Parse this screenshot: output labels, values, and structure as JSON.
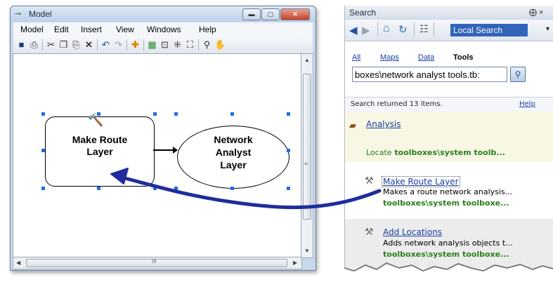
{
  "model_window": {
    "title": "Model",
    "menu": [
      "Model",
      "Edit",
      "Insert",
      "View",
      "Windows",
      "Help"
    ],
    "scroll_right_glyph": "III",
    "diagram": {
      "tool_label": "Make Route Layer",
      "data_label": "Network Analyst Layer"
    }
  },
  "search_window": {
    "title": "Search",
    "pin_glyph": "⨁ ×",
    "scope": "Local Search",
    "filters": [
      "All",
      "Maps",
      "Data",
      "Tools"
    ],
    "active_filter": "Tools",
    "query": "boxes\\network analyst tools.tb:",
    "results_text": "Search returned 13 items.",
    "help_label": "Help",
    "results": [
      {
        "title": "Analysis",
        "desc": "",
        "path_prefix": "Locate",
        "path": "toolboxes\\system toolb..."
      },
      {
        "title": "Make Route Layer",
        "desc": "Makes a route network analysis...",
        "path_prefix": "",
        "path": "toolboxes\\system toolboxe..."
      },
      {
        "title": "Add Locations",
        "desc": "Adds network analysis objects t...",
        "path_prefix": "",
        "path": "toolboxes\\system toolboxe..."
      }
    ]
  },
  "colors": {
    "drag_arrow": "#1f2d9c",
    "selection_handle": "#1f6fe0",
    "path_green": "#2a7f1d",
    "link_blue": "#1a3fa3",
    "scope_highlight": "#3264b8"
  },
  "icons": [
    "save-icon",
    "print-icon",
    "cut-icon",
    "copy-icon",
    "paste-icon",
    "delete-icon",
    "undo-icon",
    "redo-icon",
    "add-data-icon",
    "run-icon",
    "zoom-icon",
    "pan-icon",
    "back-icon",
    "forward-icon",
    "home-icon",
    "refresh-icon",
    "search-go-icon",
    "hammer-icon",
    "toolbox-icon"
  ]
}
